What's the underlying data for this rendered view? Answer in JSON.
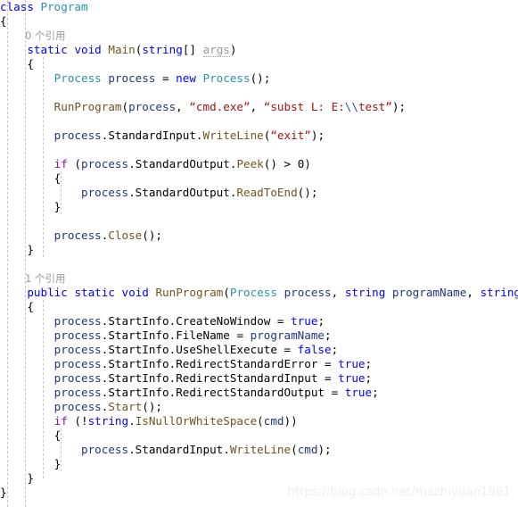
{
  "editor": {
    "language": "csharp",
    "background": "#ffffff",
    "indent_guides": [
      8,
      28,
      48,
      68
    ],
    "colors": {
      "keyword": "#0000ff",
      "control_keyword": "#8f08c4",
      "type": "#2b91af",
      "method": "#74531f",
      "string": "#a31515",
      "escape": "#0f51c9",
      "identifier": "#1f377f",
      "plain": "#000000",
      "codelens": "#9a9a9a",
      "unused_identifier": "#9a9a9a",
      "indent_guide": "#c8c8c8",
      "watermark": "#eceef0"
    }
  },
  "codelens": {
    "main_references": "0 个引用",
    "runprogram_references": "1 个引用"
  },
  "lines": {
    "l01": "class Program",
    "l02": "{",
    "l03": "0 个引用",
    "l04": "    static void Main(string[] args)",
    "l05": "    {",
    "l06": "        Process process = new Process();",
    "l07": "",
    "l08": "        RunProgram(process, “cmd.exe”, “subst L: E:\\\\test”);",
    "l09": "",
    "l10": "        process.StandardInput.WriteLine(“exit”);",
    "l11": "",
    "l12": "        if (process.StandardOutput.Peek() > 0)",
    "l13": "        {",
    "l14": "            process.StandardOutput.ReadToEnd();",
    "l15": "        }",
    "l16": "",
    "l17": "        process.Close();",
    "l18": "    }",
    "l19": "",
    "l20": "1 个引用",
    "l21": "    public static void RunProgram(Process process, string programName, string cmd)",
    "l22": "    {",
    "l23": "        process.StartInfo.CreateNoWindow = true;",
    "l24": "        process.StartInfo.FileName = programName;",
    "l25": "        process.StartInfo.UseShellExecute = false;",
    "l26": "        process.StartInfo.RedirectStandardError = true;",
    "l27": "        process.StartInfo.RedirectStandardInput = true;",
    "l28": "        process.StartInfo.RedirectStandardOutput = true;",
    "l29": "        process.Start();",
    "l30": "        if (!string.IsNullOrWhiteSpace(cmd))",
    "l31": "        {",
    "l32": "            process.StandardInput.WriteLine(cmd);",
    "l33": "        }",
    "l34": "    }",
    "l35": "}"
  },
  "tokens": {
    "kw_class": "class",
    "kw_static": "static",
    "kw_void": "void",
    "kw_new": "new",
    "kw_public": "public",
    "kw_string": "string",
    "kw_true": "true",
    "kw_false": "false",
    "kw_if": "if",
    "type_program": "Program",
    "type_process": "Process",
    "meth_main": "Main",
    "meth_runprogram": "RunProgram",
    "meth_writeline": "WriteLine",
    "meth_peek": "Peek",
    "meth_readtoend": "ReadToEnd",
    "meth_close": "Close",
    "meth_start": "Start",
    "meth_isnullorwhitespace": "IsNullOrWhiteSpace",
    "id_args": "args",
    "id_process": "process",
    "id_programname": "programName",
    "id_cmd": "cmd",
    "prop_standardinput": "StandardInput",
    "prop_standardoutput": "StandardOutput",
    "prop_startinfo": "StartInfo",
    "prop_createnowindow": "CreateNoWindow",
    "prop_filename": "FileName",
    "prop_useshellexecute": "UseShellExecute",
    "prop_redirectstandarderror": "RedirectStandardError",
    "prop_redirectstandardinput": "RedirectStandardInput",
    "prop_redirectstandardoutput": "RedirectStandardOutput",
    "str_cmdexe": "“cmd.exe”",
    "str_subst_a": "“subst L: E:",
    "str_subst_esc": "\\\\",
    "str_subst_b": "test”",
    "str_exit": "“exit”",
    "brace_open": "{",
    "brace_close": "}"
  },
  "watermark": {
    "text": "https://blog.csdn.net/mazhiyuan1981"
  }
}
